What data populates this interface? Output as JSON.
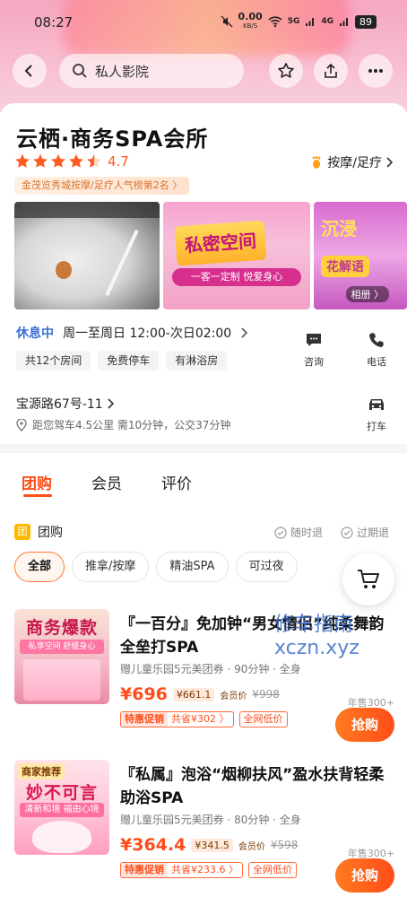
{
  "status_bar": {
    "time": "08:27",
    "net_speed": "0.00",
    "net_unit": "KB/S",
    "sig1": "5G",
    "sig2": "4G",
    "battery": "89"
  },
  "nav": {
    "search_text": "私人影院"
  },
  "shop": {
    "title": "云栖·商务SPA会所",
    "rating": "4.7",
    "stars_filled": 4.5,
    "category": "按摩/足疗",
    "rank_tag": "金茂览秀城按摩/足疗人气榜第2名",
    "gallery": [
      {
        "alt": "bath"
      },
      {
        "sign": "私密空间",
        "sub": "一客一定制 悦爱身心"
      },
      {
        "t1": "沉浸",
        "t2": "花解语",
        "album_label": "相册"
      }
    ],
    "status": "休息中",
    "hours": "周一至周日 12:00-次日02:00",
    "chips": [
      "共12个房间",
      "免费停车",
      "有淋浴房"
    ],
    "consult_label": "咨询",
    "call_label": "电话",
    "address": "宝源路67号-11",
    "distance": "距您驾车4.5公里 需10分钟，公交37分钟",
    "taxi_label": "打车"
  },
  "tabs": [
    "团购",
    "会员",
    "评价"
  ],
  "groupbuy": {
    "badge": "团",
    "title": "团购",
    "refund_any": "随时退",
    "refund_expired": "过期退",
    "filters": [
      "全部",
      "推拿/按摩",
      "精油SPA",
      "可过夜"
    ],
    "active_filter": 0,
    "deals": [
      {
        "img_head": "商务爆款",
        "img_sub": "私享空间 舒缓身心",
        "title": "『一百分』免加钟“男女情侣”纯柔舞韵全垒打SPA",
        "meta": "赠儿童乐园5元美团券 · 90分钟 · 全身",
        "price": "¥696",
        "member_price": "¥661.1",
        "member_label": "会员价",
        "orig_price": "¥998",
        "promo_a": "特惠促销",
        "promo_b": "共省¥302 〉",
        "low_tag": "全网低价",
        "sold": "年售300+",
        "buy_label": "抢购"
      },
      {
        "img_rec": "商家推荐",
        "img_head": "妙不可言",
        "img_sub": "清新和境 福由心境",
        "title": "『私属』泡浴“烟柳扶风”盈水扶背轻柔助浴SPA",
        "meta": "赠儿童乐园5元美团券 · 80分钟 · 全身",
        "price": "¥364.4",
        "member_price": "¥341.5",
        "member_label": "会员价",
        "orig_price": "¥598",
        "promo_a": "特惠促销",
        "promo_b": "共省¥233.6 〉",
        "low_tag": "全网低价",
        "sold": "年售300+",
        "buy_label": "抢购"
      }
    ]
  },
  "watermark": {
    "line1": "修车指南",
    "line2": "xczn.xyz"
  },
  "colors": {
    "accent": "#ff4d1a",
    "status_blue": "#3a6fd8",
    "gold": "#ffb800"
  }
}
